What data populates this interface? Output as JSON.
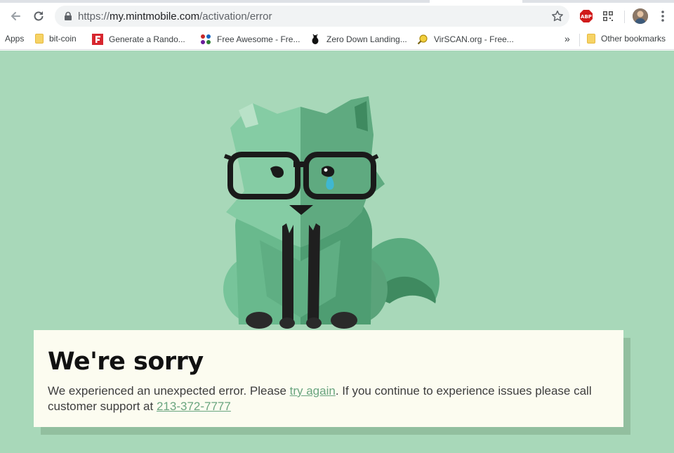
{
  "browser": {
    "url_scheme": "https://",
    "url_host": "my.mintmobile.com",
    "url_path": "/activation/error"
  },
  "bookmarks": {
    "apps": "Apps",
    "items": [
      {
        "label": "bit-coin",
        "icon": "folder-icon"
      },
      {
        "label": "Generate a Rando...",
        "icon": "f-logo-icon"
      },
      {
        "label": "Free Awesome - Fre...",
        "icon": "grid-logo-icon"
      },
      {
        "label": "Zero Down Landing...",
        "icon": "bug-logo-icon"
      },
      {
        "label": "VirSCAN.org - Free...",
        "icon": "magnifier-logo-icon"
      }
    ],
    "overflow": "»",
    "other": "Other bookmarks"
  },
  "page": {
    "title": "We're sorry",
    "message_part1": "We experienced an unexpected error. Please ",
    "try_again_link": "try again",
    "message_part2": ". If you continue to experience issues please call customer support at ",
    "phone_link": "213-372-7777"
  },
  "colors": {
    "page_bg": "#a8d8b9",
    "card_bg": "#fcfcf0",
    "link": "#6aa57f",
    "fox_light": "#7cc79e",
    "fox_dark": "#55a278"
  }
}
